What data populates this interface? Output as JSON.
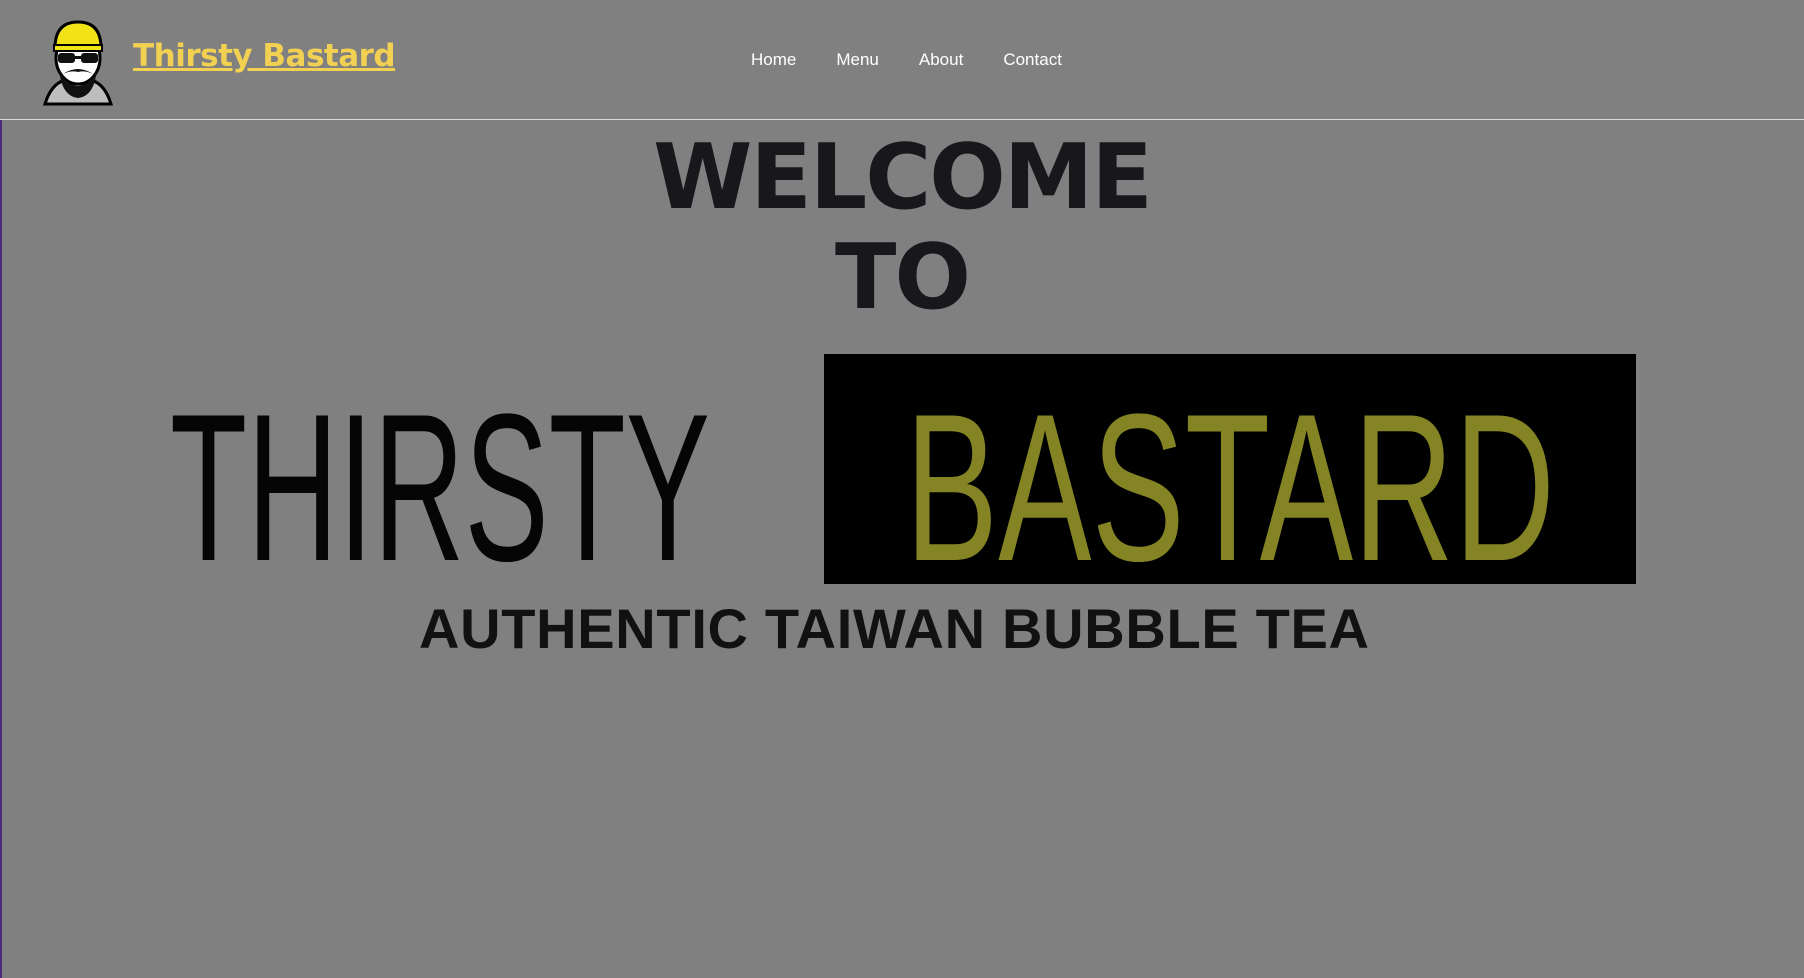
{
  "header": {
    "brand_name": "Thirsty Bastard",
    "brand_color": "#f2d052",
    "logo_icon": "bearded-man-cap-sunglasses-icon"
  },
  "nav": {
    "items": [
      {
        "label": "Home"
      },
      {
        "label": "Menu"
      },
      {
        "label": "About"
      },
      {
        "label": "Contact"
      }
    ]
  },
  "hero": {
    "line1": "WELCOME",
    "line2": "TO",
    "banner": {
      "word1": "THIRSTY",
      "word2": "BASTARD",
      "tagline": "AUTHENTIC TAIWAN BUBBLE TEA",
      "word2_color": "#848424",
      "box_color": "#000000"
    }
  },
  "colors": {
    "background": "#808080",
    "heading": "#17171c",
    "nav_text": "#ffffff"
  }
}
